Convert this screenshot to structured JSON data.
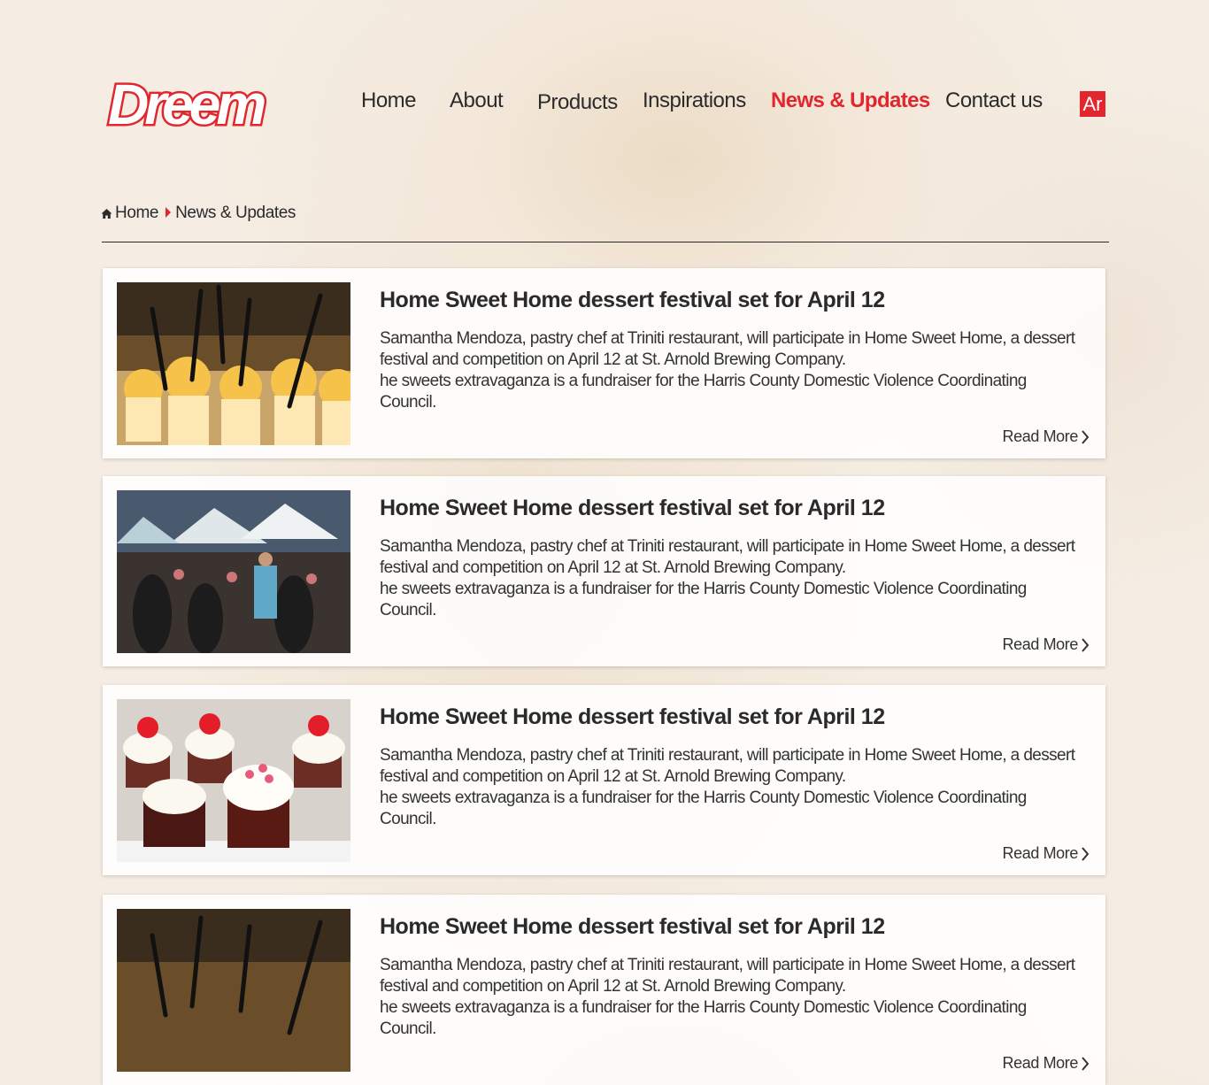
{
  "brand": {
    "logo_text": "Dreem",
    "accent": "#e1262d"
  },
  "nav": {
    "items": [
      {
        "label": "Home",
        "active": false
      },
      {
        "label": "About",
        "active": false
      },
      {
        "label": "Products",
        "active": false
      },
      {
        "label": "Inspirations",
        "active": false
      },
      {
        "label": "News & Updates",
        "active": true
      },
      {
        "label": "Contact us",
        "active": false
      }
    ],
    "lang_label": "Ar"
  },
  "breadcrumb": {
    "home": "Home",
    "current": "News & Updates",
    "home_icon": "home-icon",
    "separator_icon": "caret-right-icon"
  },
  "articles": [
    {
      "image": "dessert-cups-photo",
      "title": "Home Sweet Home dessert festival set for April 12",
      "p1": "Samantha Mendoza, pastry chef at Triniti restaurant, will participate in Home Sweet Home, a dessert festival and competition on April 12 at St. Arnold Brewing Company.",
      "p2": "he sweets extravaganza is a fundraiser for the Harris County Domestic Violence Coordinating Council.",
      "read_more": "Read More"
    },
    {
      "image": "festival-crowd-photo",
      "title": "Home Sweet Home dessert festival set for April 12",
      "p1": "Samantha Mendoza, pastry chef at Triniti restaurant, will participate in Home Sweet Home, a dessert festival and competition on April 12 at St. Arnold Brewing Company.",
      "p2": "he sweets extravaganza is a fundraiser for the Harris County Domestic Violence Coordinating Council.",
      "read_more": "Read More"
    },
    {
      "image": "cupcakes-photo",
      "title": "Home Sweet Home dessert festival set for April 12",
      "p1": "Samantha Mendoza, pastry chef at Triniti restaurant, will participate in Home Sweet Home, a dessert festival and competition on April 12 at St. Arnold Brewing Company.",
      "p2": "he sweets extravaganza is a fundraiser for the Harris County Domestic Violence Coordinating Council.",
      "read_more": "Read More"
    },
    {
      "image": "dessert-cups-photo",
      "title": "Home Sweet Home dessert festival set for April 12",
      "p1": "Samantha Mendoza, pastry chef at Triniti restaurant, will participate in Home Sweet Home, a dessert festival and competition on April 12 at St. Arnold Brewing Company.",
      "p2": "he sweets extravaganza is a fundraiser for the Harris County Domestic Violence Coordinating Council.",
      "read_more": "Read More"
    }
  ]
}
